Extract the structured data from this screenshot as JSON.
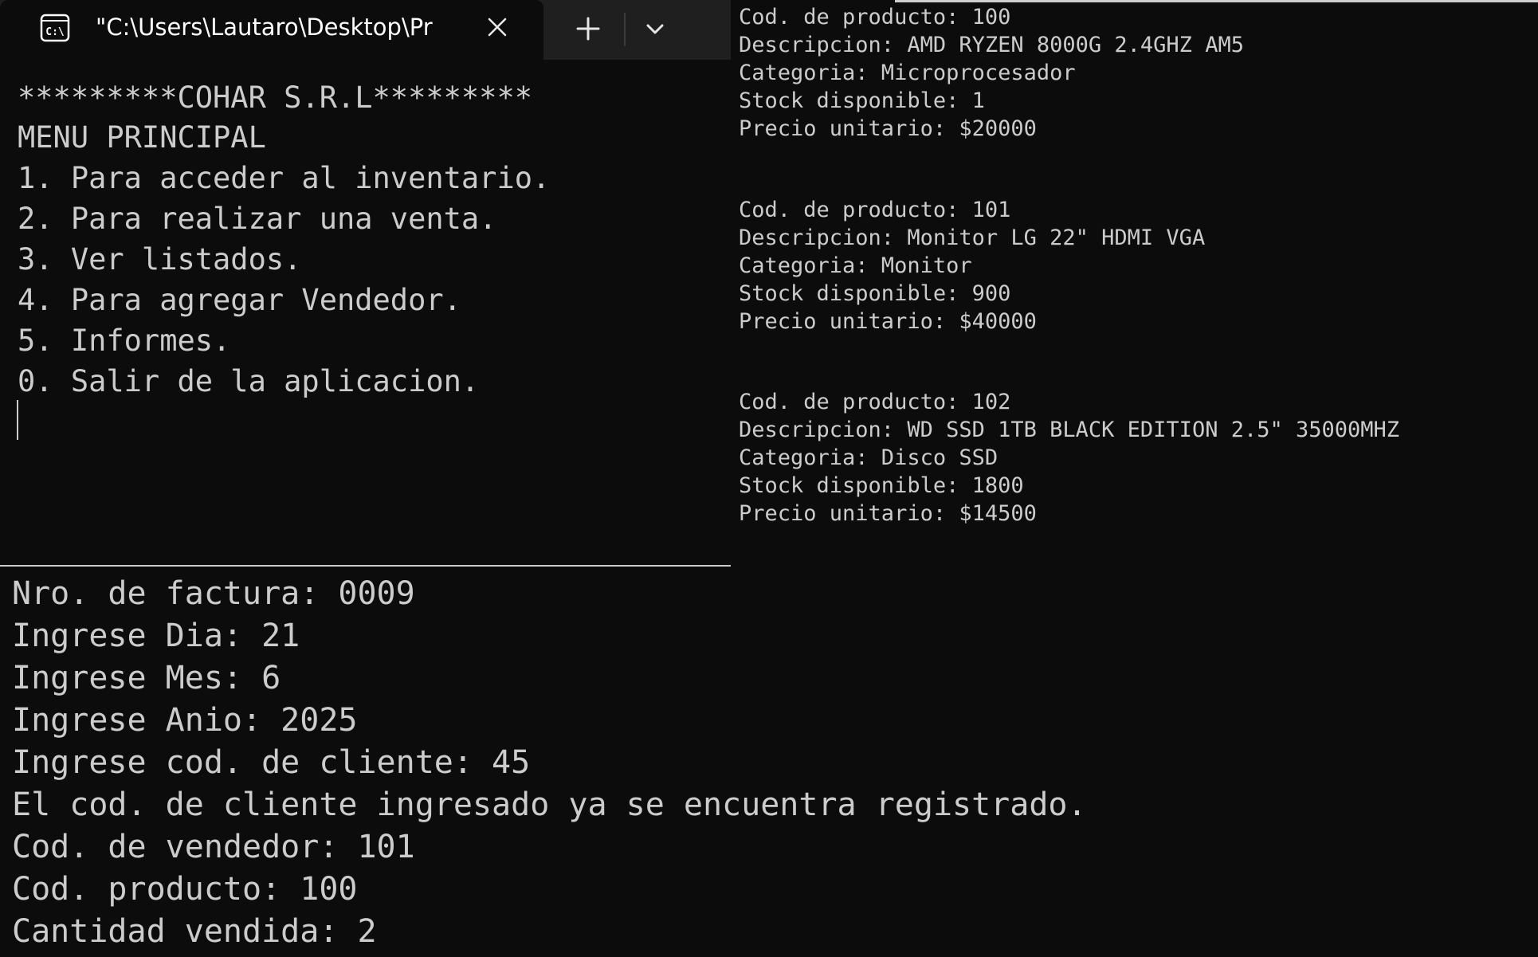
{
  "window": {
    "tab_title": "\"C:\\Users\\Lautaro\\Desktop\\Pr",
    "icons": {
      "tab": "command-prompt-icon",
      "close": "close-icon",
      "new_tab": "plus-icon",
      "dropdown": "chevron-down-icon"
    }
  },
  "menu": {
    "lines": [
      "*********COHAR S.R.L*********",
      "MENU PRINCIPAL",
      "1. Para acceder al inventario.",
      "2. Para realizar una venta.",
      "3. Ver listados.",
      "4. Para agregar Vendedor.",
      "5. Informes.",
      "0. Salir de la aplicacion."
    ]
  },
  "products": [
    {
      "code": "Cod. de producto: 100",
      "description": "Descripcion: AMD RYZEN 8000G 2.4GHZ AM5",
      "category": "Categoria: Microprocesador",
      "stock": "Stock disponible: 1",
      "price": "Precio unitario: $20000"
    },
    {
      "code": "Cod. de producto: 101",
      "description": "Descripcion: Monitor LG 22\" HDMI VGA",
      "category": "Categoria: Monitor",
      "stock": "Stock disponible: 900",
      "price": "Precio unitario: $40000"
    },
    {
      "code": "Cod. de producto: 102",
      "description": "Descripcion: WD SSD 1TB BLACK EDITION 2.5\" 35000MHZ",
      "category": "Categoria: Disco SSD",
      "stock": "Stock disponible: 1800",
      "price": "Precio unitario: $14500"
    }
  ],
  "sale": {
    "lines": [
      "Nro. de factura: 0009",
      "Ingrese Dia: 21",
      "Ingrese Mes: 6",
      "Ingrese Anio: 2025",
      "Ingrese cod. de cliente: 45",
      "El cod. de cliente ingresado ya se encuentra registrado.",
      "Cod. de vendedor: 101",
      "Cod. producto: 100",
      "Cantidad vendida: 2"
    ]
  }
}
